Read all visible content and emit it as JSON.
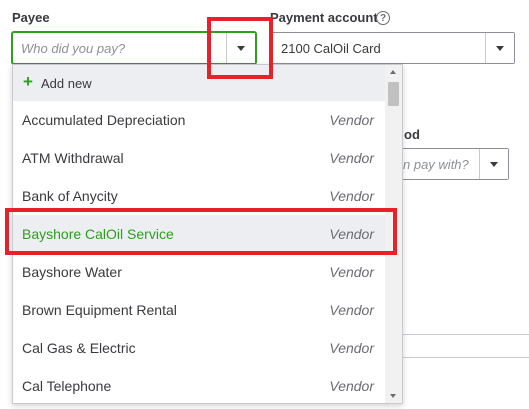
{
  "payee": {
    "label": "Payee",
    "placeholder": "Who did you pay?"
  },
  "payment_account": {
    "label": "Payment account",
    "help_icon": "?",
    "value": "2100 CalOil Card"
  },
  "payment_method": {
    "label_partial": "od",
    "placeholder_partial": "n pay with?"
  },
  "menu": {
    "add_new_label": "Add new",
    "items": [
      {
        "name": "Accumulated Depreciation",
        "type": "Vendor"
      },
      {
        "name": "ATM Withdrawal",
        "type": "Vendor"
      },
      {
        "name": "Bank of Anycity",
        "type": "Vendor"
      },
      {
        "name": "Bayshore CalOil Service",
        "type": "Vendor"
      },
      {
        "name": "Bayshore Water",
        "type": "Vendor"
      },
      {
        "name": "Brown Equipment Rental",
        "type": "Vendor"
      },
      {
        "name": "Cal Gas & Electric",
        "type": "Vendor"
      },
      {
        "name": "Cal Telephone",
        "type": "Vendor"
      }
    ],
    "highlighted_index": 3
  },
  "colors": {
    "accent_green": "#2ca01c",
    "highlight_red": "#e8202a"
  }
}
